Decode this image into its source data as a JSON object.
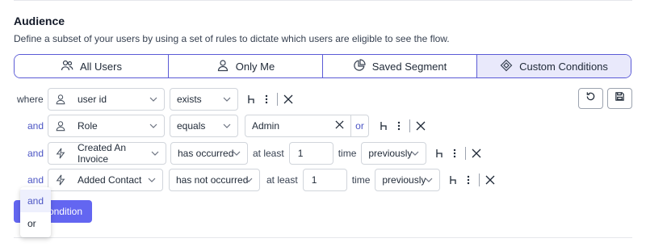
{
  "section": {
    "title": "Audience",
    "description": "Define a subset of your users by using a set of rules to dictate which users are eligible to see the flow."
  },
  "tabs": [
    {
      "label": "All Users",
      "icon": "users-icon",
      "active": false
    },
    {
      "label": "Only Me",
      "icon": "user-icon",
      "active": false
    },
    {
      "label": "Saved Segment",
      "icon": "pie-chart-icon",
      "active": false
    },
    {
      "label": "Custom Conditions",
      "icon": "diamond-icon",
      "active": true
    }
  ],
  "rows": [
    {
      "conjunction": "where",
      "field": "user id",
      "field_icon": "user-icon",
      "operator": "exists"
    },
    {
      "conjunction": "and",
      "field": "Role",
      "field_icon": "user-icon",
      "operator": "equals",
      "value": "Admin",
      "or_label": "or"
    },
    {
      "conjunction": "and",
      "field": "Created An Invoice",
      "field_icon": "bolt-icon",
      "operator": "has occurred",
      "at_least_label": "at least",
      "count": "1",
      "time_label": "time",
      "timeframe": "previously"
    },
    {
      "conjunction": "and",
      "field": "Added Contact",
      "field_icon": "bolt-icon",
      "operator": "has not occurred",
      "at_least_label": "at least",
      "count": "1",
      "time_label": "time",
      "timeframe": "previously"
    }
  ],
  "add_button": {
    "label_visible": "ondition"
  },
  "conjunction_dropdown": {
    "options": [
      "and",
      "or"
    ],
    "highlighted": "and"
  },
  "colors": {
    "accent": "#6366f1",
    "link": "#4b55c4",
    "active_tab": "#e9e9fb"
  }
}
